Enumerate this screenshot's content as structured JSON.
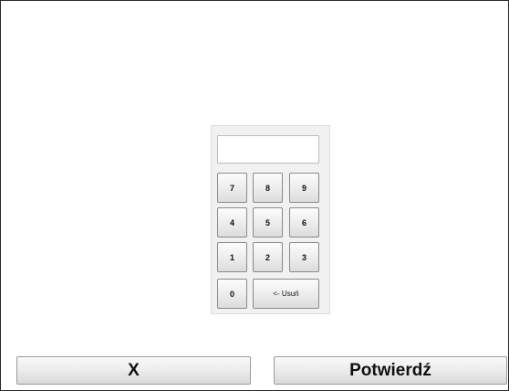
{
  "keypad": {
    "display_value": "",
    "keys": {
      "k7": "7",
      "k8": "8",
      "k9": "9",
      "k4": "4",
      "k5": "5",
      "k6": "6",
      "k1": "1",
      "k2": "2",
      "k3": "3",
      "k0": "0",
      "backspace": "<- Usuń"
    }
  },
  "actions": {
    "cancel_label": "X",
    "confirm_label": "Potwierdź"
  }
}
